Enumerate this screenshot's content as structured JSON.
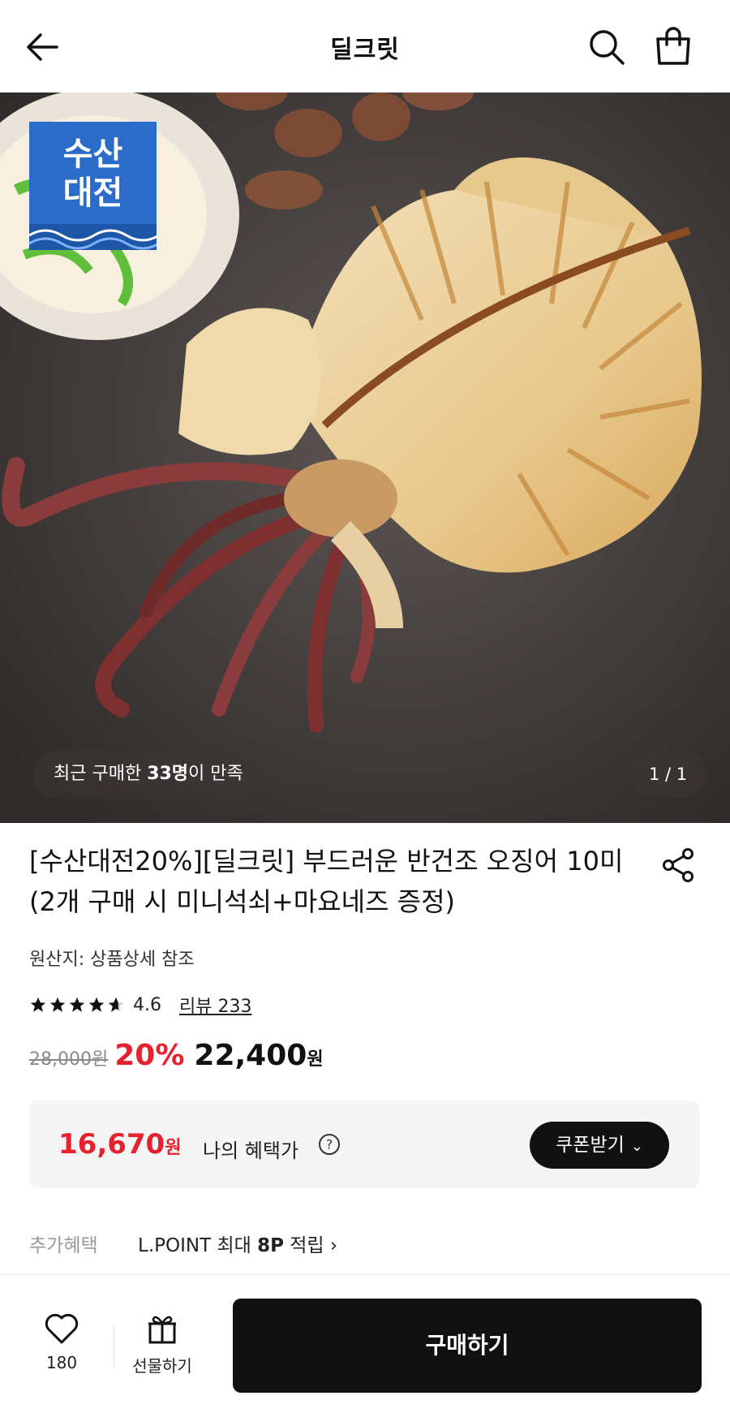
{
  "header": {
    "title": "딜크릿",
    "icons": {
      "back": "arrow-left-icon",
      "search": "search-icon",
      "cart": "shopping-bag-icon"
    }
  },
  "hero": {
    "badge_line1": "수산",
    "badge_line2": "대전",
    "satisfied_prefix": "최근 구매한 ",
    "satisfied_count": "33명",
    "satisfied_suffix": "이 만족",
    "pager": "1 / 1"
  },
  "product": {
    "title": "[수산대전20%][딜크릿] 부드러운 반건조 오징어 10미 (2개 구매 시 미니석쇠+마요네즈 증정)",
    "origin": "원산지: 상품상세 참조",
    "rating": "4.6",
    "rating_value": 4.6,
    "review_link": "리뷰 233",
    "original_price": "28,000원",
    "discount": "20%",
    "final_price": "22,400",
    "currency": "원"
  },
  "benefit": {
    "price": "16,670",
    "currency": "원",
    "label": "나의 혜택가",
    "coupon_button": "쿠폰받기"
  },
  "extra": {
    "label": "추가혜택",
    "prefix": "L.POINT 최대 ",
    "points": "8P",
    "suffix": " 적립"
  },
  "bottom_bar": {
    "like_count": "180",
    "gift_label": "선물하기",
    "buy_button": "구매하기"
  },
  "colors": {
    "accent_red": "#e5222d",
    "badge_blue": "#2b6cc9",
    "button_black": "#111111"
  }
}
